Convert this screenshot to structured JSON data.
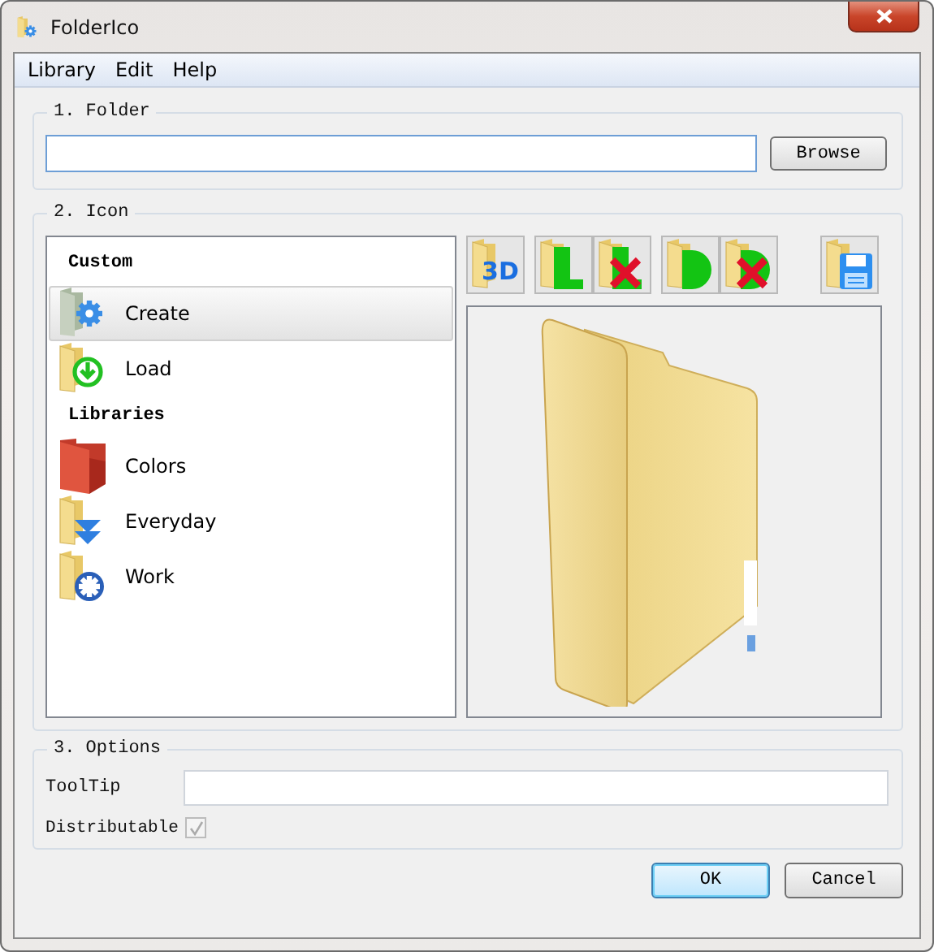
{
  "window": {
    "title": "FolderIco"
  },
  "menu": [
    {
      "label": "Library"
    },
    {
      "label": "Edit"
    },
    {
      "label": "Help"
    }
  ],
  "folder_group": {
    "title": "1. Folder",
    "browse_button": "Browse"
  },
  "icon_group": {
    "title": "2. Icon",
    "sections": [
      {
        "heading": "Custom",
        "items": [
          {
            "label": "Create",
            "kind": "create",
            "selected": true
          },
          {
            "label": "Load",
            "kind": "load",
            "selected": false
          }
        ]
      },
      {
        "heading": "Libraries",
        "items": [
          {
            "label": "Colors",
            "kind": "colors",
            "selected": false
          },
          {
            "label": "Everyday",
            "kind": "everyday",
            "selected": false
          },
          {
            "label": "Work",
            "kind": "work",
            "selected": false
          }
        ]
      }
    ],
    "toolbar": [
      [
        {
          "kind": "threed",
          "label": "3D"
        }
      ],
      [
        {
          "kind": "tab"
        },
        {
          "kind": "tab-delete"
        }
      ],
      [
        {
          "kind": "round"
        },
        {
          "kind": "round-delete"
        }
      ],
      [
        {
          "kind": "save"
        }
      ]
    ]
  },
  "options_group": {
    "title": "3. Options",
    "tooltip": {
      "label": "ToolTip"
    },
    "distributable": {
      "label": "Distributable",
      "checked": true,
      "disabled": true
    }
  },
  "buttons": [
    {
      "label": "OK",
      "default": true
    },
    {
      "label": "Cancel",
      "default": false
    }
  ]
}
